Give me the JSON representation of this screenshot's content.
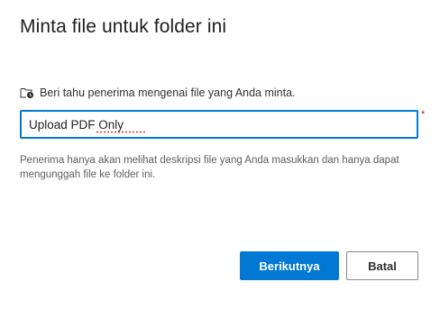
{
  "dialog": {
    "title": "Minta file untuk folder ini",
    "prompt_icon": "folder-clock-icon",
    "prompt_label": "Beri tahu penerima mengenai file yang Anda minta.",
    "input_value": "Upload PDF Only",
    "required_marker": "*",
    "help_text": "Penerima hanya akan melihat deskripsi file yang Anda masukkan dan hanya dapat mengunggah file ke folder ini.",
    "next_button": "Berikutnya",
    "cancel_button": "Batal"
  },
  "colors": {
    "accent": "#0078d4",
    "required": "#a4262c",
    "spellcheck": "#d13438"
  }
}
